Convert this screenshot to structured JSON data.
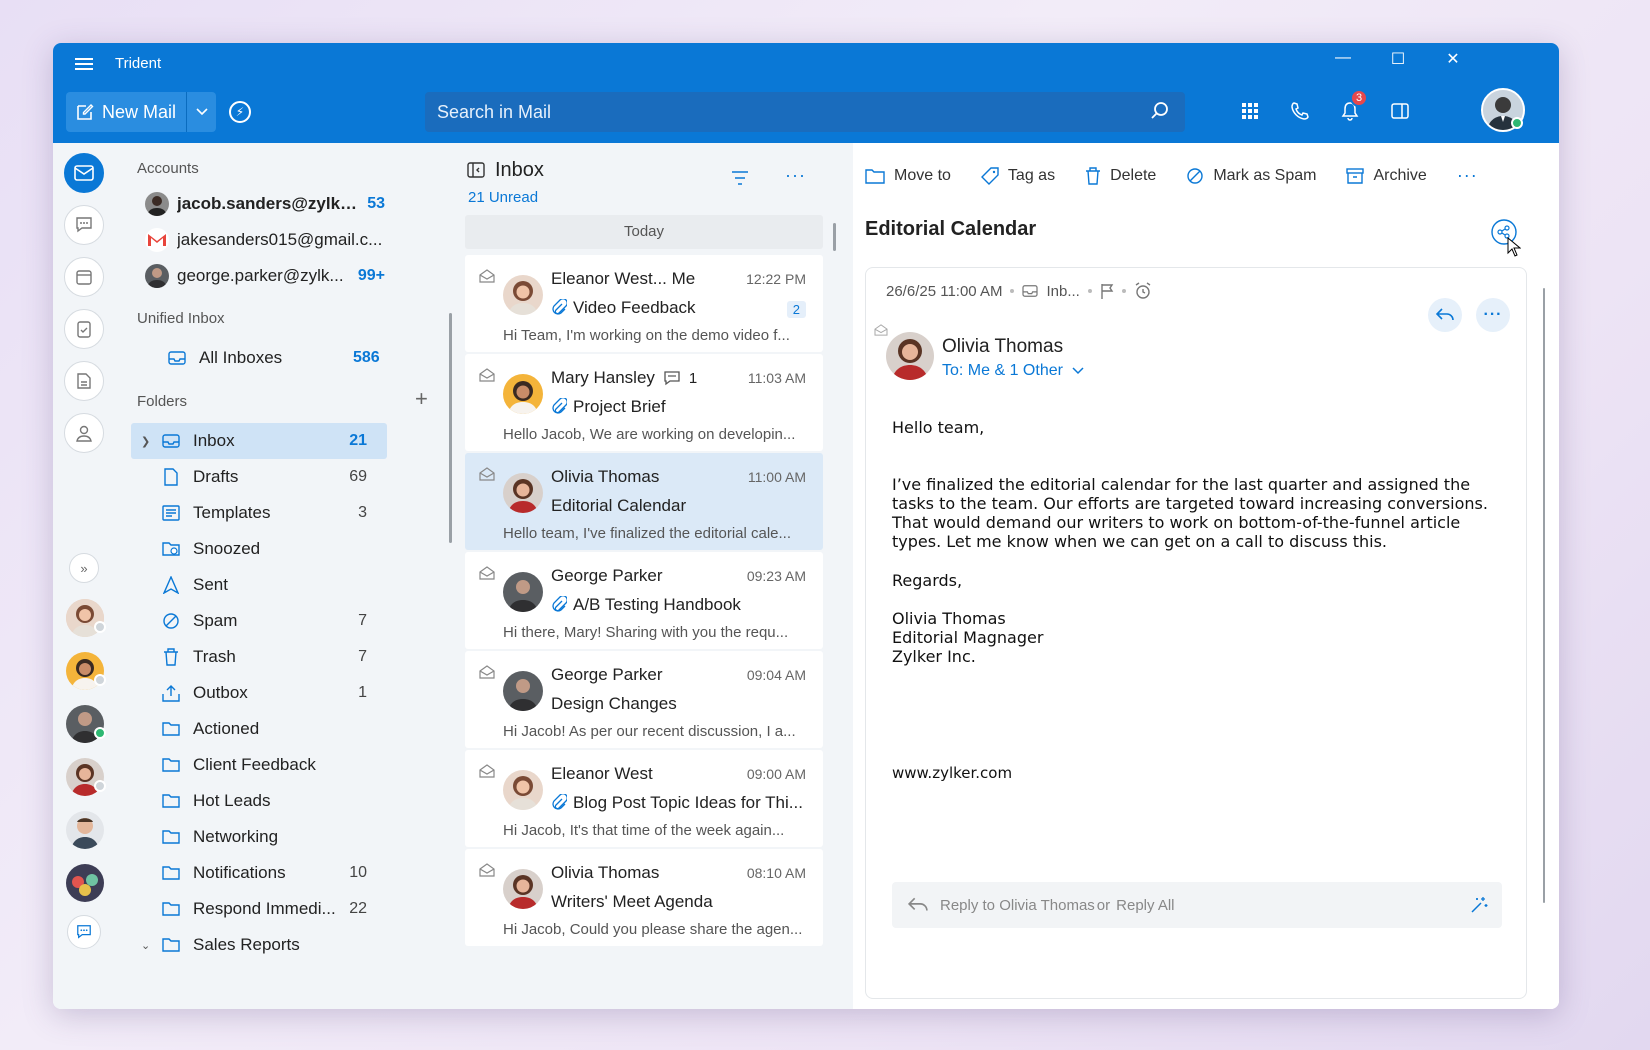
{
  "window": {
    "title": "Trident"
  },
  "header": {
    "new_mail": "New Mail",
    "search_placeholder": "Search in Mail",
    "notification_count": "3"
  },
  "nav": {
    "accounts_label": "Accounts",
    "accounts": [
      {
        "name": "jacob.sanders@zylke...",
        "count": "53"
      },
      {
        "name": "jakesanders015@gmail.c...",
        "count": ""
      },
      {
        "name": "george.parker@zylk...",
        "count": "99+"
      }
    ],
    "unified_label": "Unified Inbox",
    "all_inboxes": {
      "name": "All Inboxes",
      "count": "586"
    },
    "folders_label": "Folders",
    "folders": [
      {
        "name": "Inbox",
        "count": "21"
      },
      {
        "name": "Drafts",
        "count": "69"
      },
      {
        "name": "Templates",
        "count": "3"
      },
      {
        "name": "Snoozed",
        "count": ""
      },
      {
        "name": "Sent",
        "count": ""
      },
      {
        "name": "Spam",
        "count": "7"
      },
      {
        "name": "Trash",
        "count": "7"
      },
      {
        "name": "Outbox",
        "count": "1"
      },
      {
        "name": "Actioned",
        "count": ""
      },
      {
        "name": "Client Feedback",
        "count": ""
      },
      {
        "name": "Hot Leads",
        "count": ""
      },
      {
        "name": "Networking",
        "count": ""
      },
      {
        "name": "Notifications",
        "count": "10"
      },
      {
        "name": "Respond Immedi...",
        "count": "22"
      },
      {
        "name": "Sales Reports",
        "count": ""
      }
    ]
  },
  "list": {
    "title": "Inbox",
    "unread": "21 Unread",
    "today": "Today",
    "messages": [
      {
        "from": "Eleanor West... Me",
        "time": "12:22 PM",
        "subject": "Video Feedback",
        "preview": "Hi Team, I'm working on the demo video f...",
        "count": "2"
      },
      {
        "from": "Mary Hansley",
        "comments": "1",
        "time": "11:03 AM",
        "subject": "Project Brief",
        "preview": "Hello Jacob, We are working on developin..."
      },
      {
        "from": "Olivia Thomas",
        "time": "11:00 AM",
        "subject": "Editorial Calendar",
        "preview": "Hello team, I've finalized the editorial cale..."
      },
      {
        "from": "George Parker",
        "time": "09:23 AM",
        "subject": "A/B Testing Handbook",
        "preview": "Hi there, Mary! Sharing with you the requ..."
      },
      {
        "from": "George Parker",
        "time": "09:04 AM",
        "subject": "Design Changes",
        "preview": "Hi Jacob! As per our recent discussion, I a..."
      },
      {
        "from": "Eleanor West",
        "time": "09:00 AM",
        "subject": "Blog Post Topic Ideas for Thi...",
        "preview": "Hi Jacob, It's that time of the week again..."
      },
      {
        "from": "Olivia Thomas",
        "time": "08:10 AM",
        "subject": "Writers' Meet Agenda",
        "preview": "Hi Jacob, Could you please share the agen..."
      }
    ]
  },
  "reader": {
    "toolbar": {
      "move": "Move to",
      "tag": "Tag as",
      "delete": "Delete",
      "spam": "Mark as Spam",
      "archive": "Archive"
    },
    "title": "Editorial Calendar",
    "date": "26/6/25 11:00 AM",
    "folder": "Inb...",
    "sender": "Olivia Thomas",
    "to": "To: Me & 1 Other",
    "greeting": "Hello team,",
    "para1": "I’ve finalized the editorial calendar for the last quarter and assigned the tasks to the team. Our efforts are targeted toward increasing conversions. That would demand our writers to work on bottom-of-the-funnel article types. Let me know when we can get on a call to discuss this.",
    "regards": "Regards,",
    "sig_name": "Olivia Thomas",
    "sig_title": "Editorial Magnager",
    "sig_company": "Zylker Inc.",
    "website": "www.zylker.com",
    "reply_to": "Reply to Olivia Thomas",
    "reply_or": "or",
    "reply_all": "Reply All"
  },
  "colors": {
    "accent": "#0a78d6",
    "selected": "#cfe3f6",
    "badge": "#e5484d"
  }
}
